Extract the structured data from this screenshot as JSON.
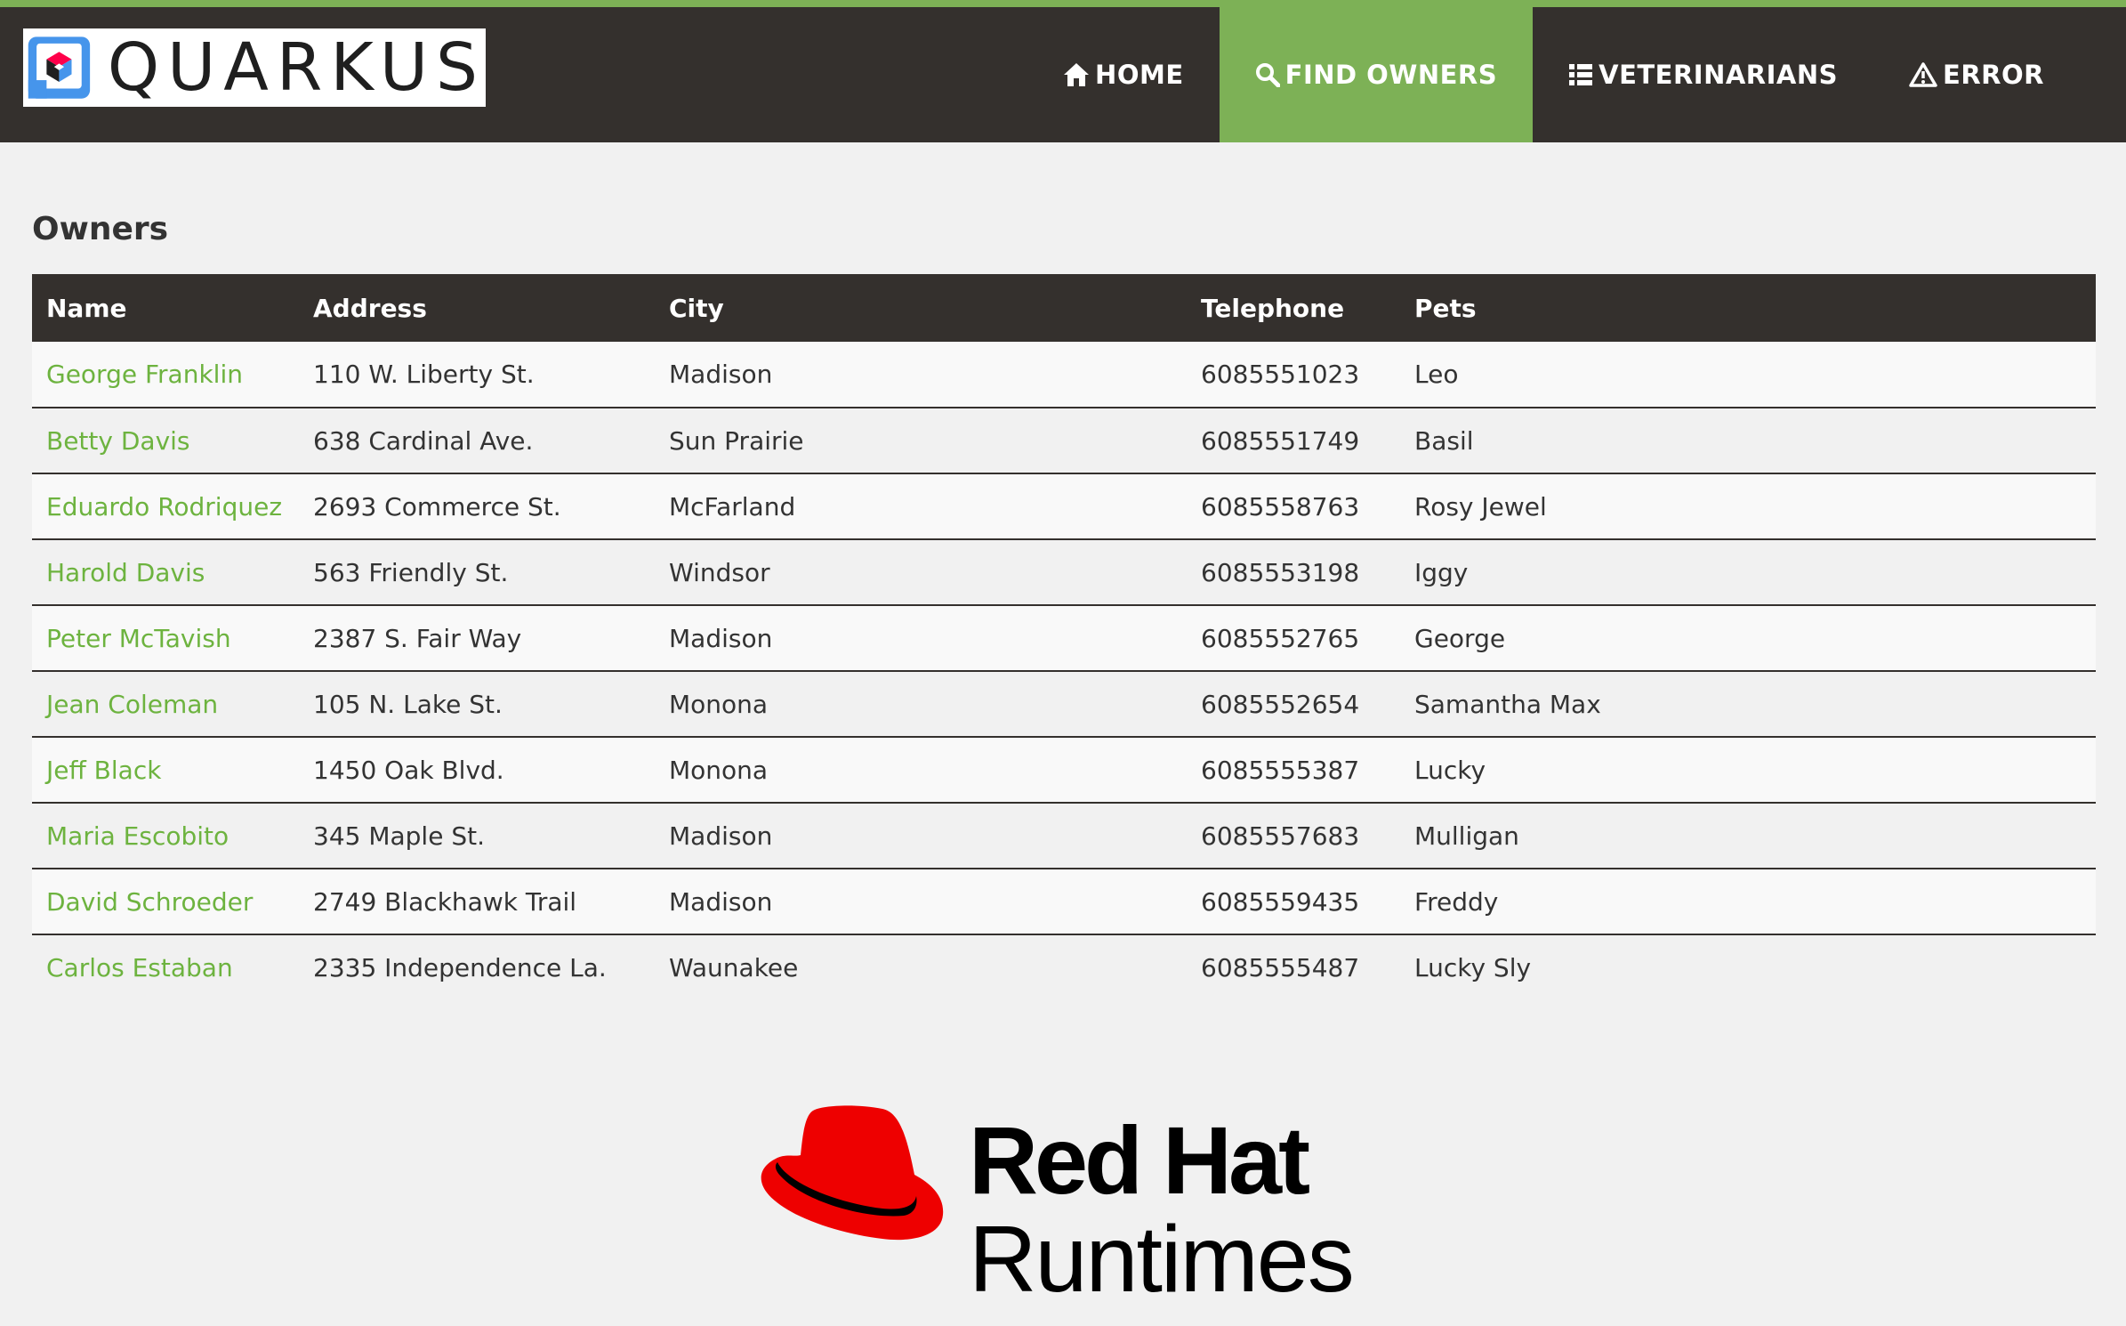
{
  "brand": {
    "logo_text": "QUARKUS"
  },
  "nav": {
    "items": [
      {
        "label": "HOME",
        "icon": "home-icon"
      },
      {
        "label": "FIND OWNERS",
        "icon": "search-icon",
        "active": true
      },
      {
        "label": "VETERINARIANS",
        "icon": "list-icon"
      },
      {
        "label": "ERROR",
        "icon": "warning-icon"
      }
    ]
  },
  "page": {
    "title": "Owners"
  },
  "table": {
    "headers": [
      "Name",
      "Address",
      "City",
      "Telephone",
      "Pets"
    ],
    "rows": [
      {
        "name": "George Franklin",
        "address": "110 W. Liberty St.",
        "city": "Madison",
        "telephone": "6085551023",
        "pets": "Leo"
      },
      {
        "name": "Betty Davis",
        "address": "638 Cardinal Ave.",
        "city": "Sun Prairie",
        "telephone": "6085551749",
        "pets": "Basil"
      },
      {
        "name": "Eduardo Rodriquez",
        "address": "2693 Commerce St.",
        "city": "McFarland",
        "telephone": "6085558763",
        "pets": "Rosy Jewel"
      },
      {
        "name": "Harold Davis",
        "address": "563 Friendly St.",
        "city": "Windsor",
        "telephone": "6085553198",
        "pets": "Iggy"
      },
      {
        "name": "Peter McTavish",
        "address": "2387 S. Fair Way",
        "city": "Madison",
        "telephone": "6085552765",
        "pets": "George"
      },
      {
        "name": "Jean Coleman",
        "address": "105 N. Lake St.",
        "city": "Monona",
        "telephone": "6085552654",
        "pets": "Samantha Max"
      },
      {
        "name": "Jeff Black",
        "address": "1450 Oak Blvd.",
        "city": "Monona",
        "telephone": "6085555387",
        "pets": "Lucky"
      },
      {
        "name": "Maria Escobito",
        "address": "345 Maple St.",
        "city": "Madison",
        "telephone": "6085557683",
        "pets": "Mulligan"
      },
      {
        "name": "David Schroeder",
        "address": "2749 Blackhawk Trail",
        "city": "Madison",
        "telephone": "6085559435",
        "pets": "Freddy"
      },
      {
        "name": "Carlos Estaban",
        "address": "2335 Independence La.",
        "city": "Waunakee",
        "telephone": "6085555487",
        "pets": "Lucky Sly"
      }
    ]
  },
  "footer": {
    "logo_line1": "Red Hat",
    "logo_line2": "Runtimes"
  },
  "colors": {
    "accent": "#7db156",
    "link": "#6db33f",
    "navbar": "#34302d",
    "background": "#f1f1f1",
    "redhat_red": "#ee0000"
  }
}
